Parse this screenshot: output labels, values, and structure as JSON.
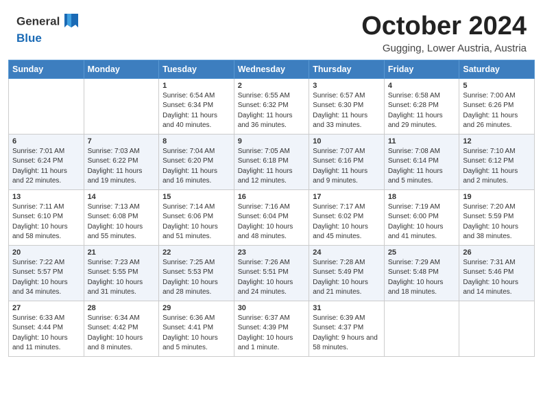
{
  "header": {
    "logo_line1": "General",
    "logo_line2": "Blue",
    "month_title": "October 2024",
    "location": "Gugging, Lower Austria, Austria"
  },
  "weekdays": [
    "Sunday",
    "Monday",
    "Tuesday",
    "Wednesday",
    "Thursday",
    "Friday",
    "Saturday"
  ],
  "weeks": [
    [
      {
        "day": "",
        "info": ""
      },
      {
        "day": "",
        "info": ""
      },
      {
        "day": "1",
        "info": "Sunrise: 6:54 AM\nSunset: 6:34 PM\nDaylight: 11 hours and 40 minutes."
      },
      {
        "day": "2",
        "info": "Sunrise: 6:55 AM\nSunset: 6:32 PM\nDaylight: 11 hours and 36 minutes."
      },
      {
        "day": "3",
        "info": "Sunrise: 6:57 AM\nSunset: 6:30 PM\nDaylight: 11 hours and 33 minutes."
      },
      {
        "day": "4",
        "info": "Sunrise: 6:58 AM\nSunset: 6:28 PM\nDaylight: 11 hours and 29 minutes."
      },
      {
        "day": "5",
        "info": "Sunrise: 7:00 AM\nSunset: 6:26 PM\nDaylight: 11 hours and 26 minutes."
      }
    ],
    [
      {
        "day": "6",
        "info": "Sunrise: 7:01 AM\nSunset: 6:24 PM\nDaylight: 11 hours and 22 minutes."
      },
      {
        "day": "7",
        "info": "Sunrise: 7:03 AM\nSunset: 6:22 PM\nDaylight: 11 hours and 19 minutes."
      },
      {
        "day": "8",
        "info": "Sunrise: 7:04 AM\nSunset: 6:20 PM\nDaylight: 11 hours and 16 minutes."
      },
      {
        "day": "9",
        "info": "Sunrise: 7:05 AM\nSunset: 6:18 PM\nDaylight: 11 hours and 12 minutes."
      },
      {
        "day": "10",
        "info": "Sunrise: 7:07 AM\nSunset: 6:16 PM\nDaylight: 11 hours and 9 minutes."
      },
      {
        "day": "11",
        "info": "Sunrise: 7:08 AM\nSunset: 6:14 PM\nDaylight: 11 hours and 5 minutes."
      },
      {
        "day": "12",
        "info": "Sunrise: 7:10 AM\nSunset: 6:12 PM\nDaylight: 11 hours and 2 minutes."
      }
    ],
    [
      {
        "day": "13",
        "info": "Sunrise: 7:11 AM\nSunset: 6:10 PM\nDaylight: 10 hours and 58 minutes."
      },
      {
        "day": "14",
        "info": "Sunrise: 7:13 AM\nSunset: 6:08 PM\nDaylight: 10 hours and 55 minutes."
      },
      {
        "day": "15",
        "info": "Sunrise: 7:14 AM\nSunset: 6:06 PM\nDaylight: 10 hours and 51 minutes."
      },
      {
        "day": "16",
        "info": "Sunrise: 7:16 AM\nSunset: 6:04 PM\nDaylight: 10 hours and 48 minutes."
      },
      {
        "day": "17",
        "info": "Sunrise: 7:17 AM\nSunset: 6:02 PM\nDaylight: 10 hours and 45 minutes."
      },
      {
        "day": "18",
        "info": "Sunrise: 7:19 AM\nSunset: 6:00 PM\nDaylight: 10 hours and 41 minutes."
      },
      {
        "day": "19",
        "info": "Sunrise: 7:20 AM\nSunset: 5:59 PM\nDaylight: 10 hours and 38 minutes."
      }
    ],
    [
      {
        "day": "20",
        "info": "Sunrise: 7:22 AM\nSunset: 5:57 PM\nDaylight: 10 hours and 34 minutes."
      },
      {
        "day": "21",
        "info": "Sunrise: 7:23 AM\nSunset: 5:55 PM\nDaylight: 10 hours and 31 minutes."
      },
      {
        "day": "22",
        "info": "Sunrise: 7:25 AM\nSunset: 5:53 PM\nDaylight: 10 hours and 28 minutes."
      },
      {
        "day": "23",
        "info": "Sunrise: 7:26 AM\nSunset: 5:51 PM\nDaylight: 10 hours and 24 minutes."
      },
      {
        "day": "24",
        "info": "Sunrise: 7:28 AM\nSunset: 5:49 PM\nDaylight: 10 hours and 21 minutes."
      },
      {
        "day": "25",
        "info": "Sunrise: 7:29 AM\nSunset: 5:48 PM\nDaylight: 10 hours and 18 minutes."
      },
      {
        "day": "26",
        "info": "Sunrise: 7:31 AM\nSunset: 5:46 PM\nDaylight: 10 hours and 14 minutes."
      }
    ],
    [
      {
        "day": "27",
        "info": "Sunrise: 6:33 AM\nSunset: 4:44 PM\nDaylight: 10 hours and 11 minutes."
      },
      {
        "day": "28",
        "info": "Sunrise: 6:34 AM\nSunset: 4:42 PM\nDaylight: 10 hours and 8 minutes."
      },
      {
        "day": "29",
        "info": "Sunrise: 6:36 AM\nSunset: 4:41 PM\nDaylight: 10 hours and 5 minutes."
      },
      {
        "day": "30",
        "info": "Sunrise: 6:37 AM\nSunset: 4:39 PM\nDaylight: 10 hours and 1 minute."
      },
      {
        "day": "31",
        "info": "Sunrise: 6:39 AM\nSunset: 4:37 PM\nDaylight: 9 hours and 58 minutes."
      },
      {
        "day": "",
        "info": ""
      },
      {
        "day": "",
        "info": ""
      }
    ]
  ]
}
